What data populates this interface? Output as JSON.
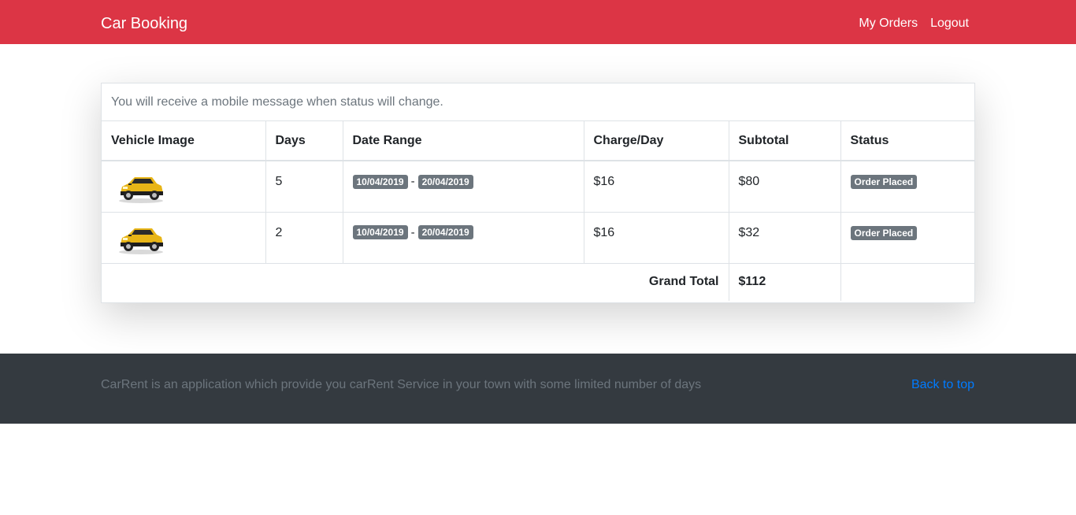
{
  "navbar": {
    "brand": "Car Booking",
    "links": [
      "My Orders",
      "Logout"
    ],
    "background": "#dc3545"
  },
  "card": {
    "notice": "You will receive a mobile message when status will change.",
    "columns": [
      "Vehicle Image",
      "Days",
      "Date Range",
      "Charge/Day",
      "Subtotal",
      "Status"
    ],
    "rows": [
      {
        "days": "5",
        "from": "10/04/2019",
        "to": "20/04/2019",
        "charge": "$16",
        "subtotal": "$80",
        "status": "Order Placed"
      },
      {
        "days": "2",
        "from": "10/04/2019",
        "to": "20/04/2019",
        "charge": "$16",
        "subtotal": "$32",
        "status": "Order Placed"
      }
    ],
    "date_separator": "-",
    "grand_total_label": "Grand Total",
    "grand_total_value": "$112"
  },
  "footer": {
    "text": "CarRent is an application which provide you carRent Service in your town with some limited number of days",
    "back_to_top": "Back to top",
    "background": "#343a40"
  }
}
